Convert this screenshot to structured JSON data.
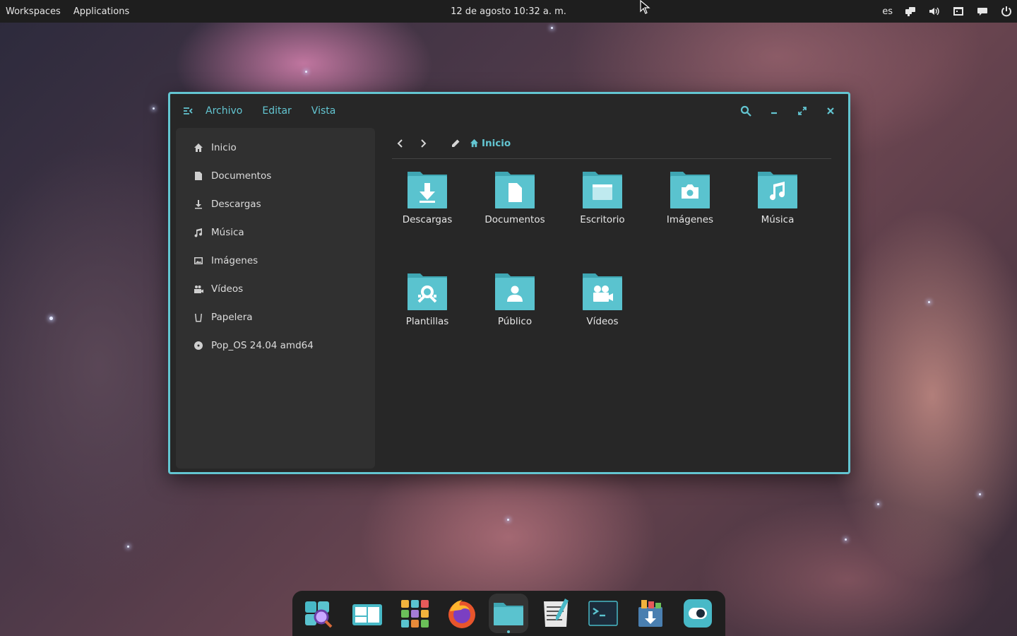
{
  "topbar": {
    "workspaces_label": "Workspaces",
    "applications_label": "Applications",
    "clock": "12 de agosto 10:32 a. m.",
    "keyboard_layout": "es",
    "tray_icons": [
      "network-icon",
      "volume-icon",
      "calendar-icon",
      "chat-icon",
      "power-icon"
    ]
  },
  "window": {
    "menu": {
      "archivo": "Archivo",
      "editar": "Editar",
      "vista": "Vista"
    },
    "sidebar": {
      "items": [
        {
          "label": "Inicio",
          "icon": "home-icon"
        },
        {
          "label": "Documentos",
          "icon": "document-icon"
        },
        {
          "label": "Descargas",
          "icon": "download-icon"
        },
        {
          "label": "Música",
          "icon": "music-icon"
        },
        {
          "label": "Imágenes",
          "icon": "image-icon"
        },
        {
          "label": "Vídeos",
          "icon": "video-icon"
        },
        {
          "label": "Papelera",
          "icon": "trash-icon"
        },
        {
          "label": "Pop_OS 24.04 amd64",
          "icon": "disc-icon"
        }
      ]
    },
    "breadcrumb": {
      "current": "Inicio"
    },
    "folders": [
      {
        "label": "Descargas",
        "icon": "download-icon"
      },
      {
        "label": "Documentos",
        "icon": "document-icon"
      },
      {
        "label": "Escritorio",
        "icon": "desktop-icon"
      },
      {
        "label": "Imágenes",
        "icon": "camera-icon"
      },
      {
        "label": "Música",
        "icon": "music-icon"
      },
      {
        "label": "Plantillas",
        "icon": "template-icon"
      },
      {
        "label": "Público",
        "icon": "person-icon"
      },
      {
        "label": "Vídeos",
        "icon": "video-camera-icon"
      }
    ]
  },
  "dock": {
    "apps": [
      {
        "name": "search-launcher-icon"
      },
      {
        "name": "workspaces-icon"
      },
      {
        "name": "app-grid-icon"
      },
      {
        "name": "firefox-icon"
      },
      {
        "name": "files-icon",
        "active": true
      },
      {
        "name": "text-editor-icon"
      },
      {
        "name": "terminal-icon"
      },
      {
        "name": "pop-shop-icon"
      },
      {
        "name": "settings-toggle-icon"
      }
    ]
  },
  "colors": {
    "accent": "#63c5d1",
    "window_bg": "#272727",
    "sidebar_bg": "#303030",
    "topbar_bg": "#1e1e1e",
    "folder": "#48b9c7"
  }
}
